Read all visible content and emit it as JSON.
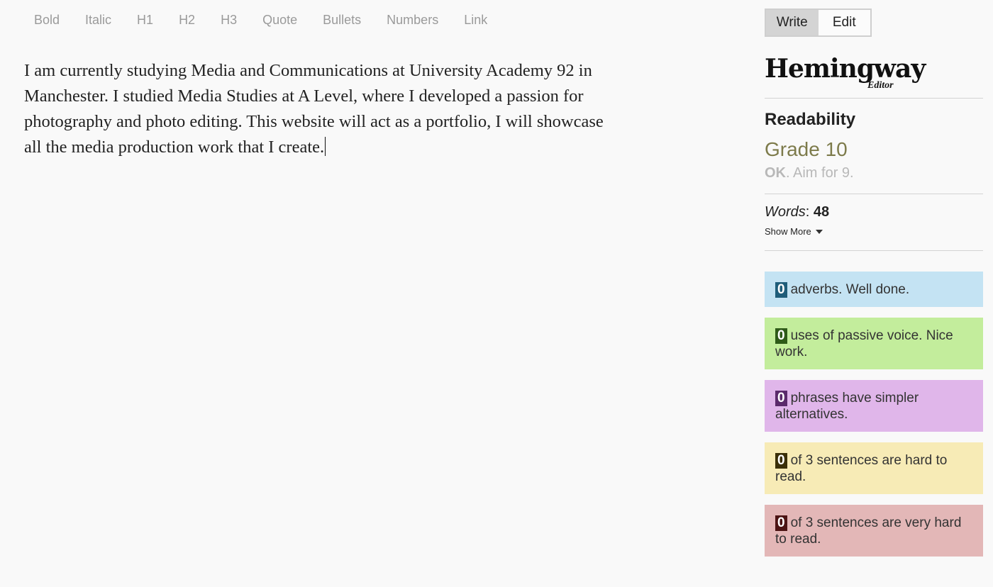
{
  "toolbar": {
    "buttons": [
      "Bold",
      "Italic",
      "H1",
      "H2",
      "H3",
      "Quote",
      "Bullets",
      "Numbers",
      "Link"
    ]
  },
  "editor": {
    "text": " I am currently studying Media and Communications at University Academy 92 in Manchester. I studied Media Studies at A Level, where I developed a passion for photography and photo editing. This website will act as a portfolio, I will showcase all the media production work that I create."
  },
  "mode": {
    "write": "Write",
    "edit": "Edit",
    "active": "Write"
  },
  "logo": {
    "main": "Hemingway",
    "sub": "Editor"
  },
  "readability": {
    "title": "Readability",
    "grade": "Grade 10",
    "ok": "OK",
    "aim": ". Aim for 9."
  },
  "stats": {
    "words_label": "Words",
    "words_sep": ":",
    "words_count": "48",
    "show_more": "Show More"
  },
  "cards": [
    {
      "num": "0",
      "text": "adverbs. Well done."
    },
    {
      "num": "0",
      "text": "uses of passive voice. Nice work."
    },
    {
      "num": "0",
      "text": "phrases have simpler alternatives."
    },
    {
      "num": "0",
      "text": "of 3 sentences are hard to read."
    },
    {
      "num": "0",
      "text": "of 3 sentences are very hard to read."
    }
  ],
  "colors": {
    "adverbs_bg": "#c4e3f3",
    "passive_bg": "#c3ed9c",
    "phrases_bg": "#e0b6ea",
    "hard_bg": "#f7ebb6",
    "very_hard_bg": "#e3b7b7",
    "grade": "#7d7b4b"
  }
}
